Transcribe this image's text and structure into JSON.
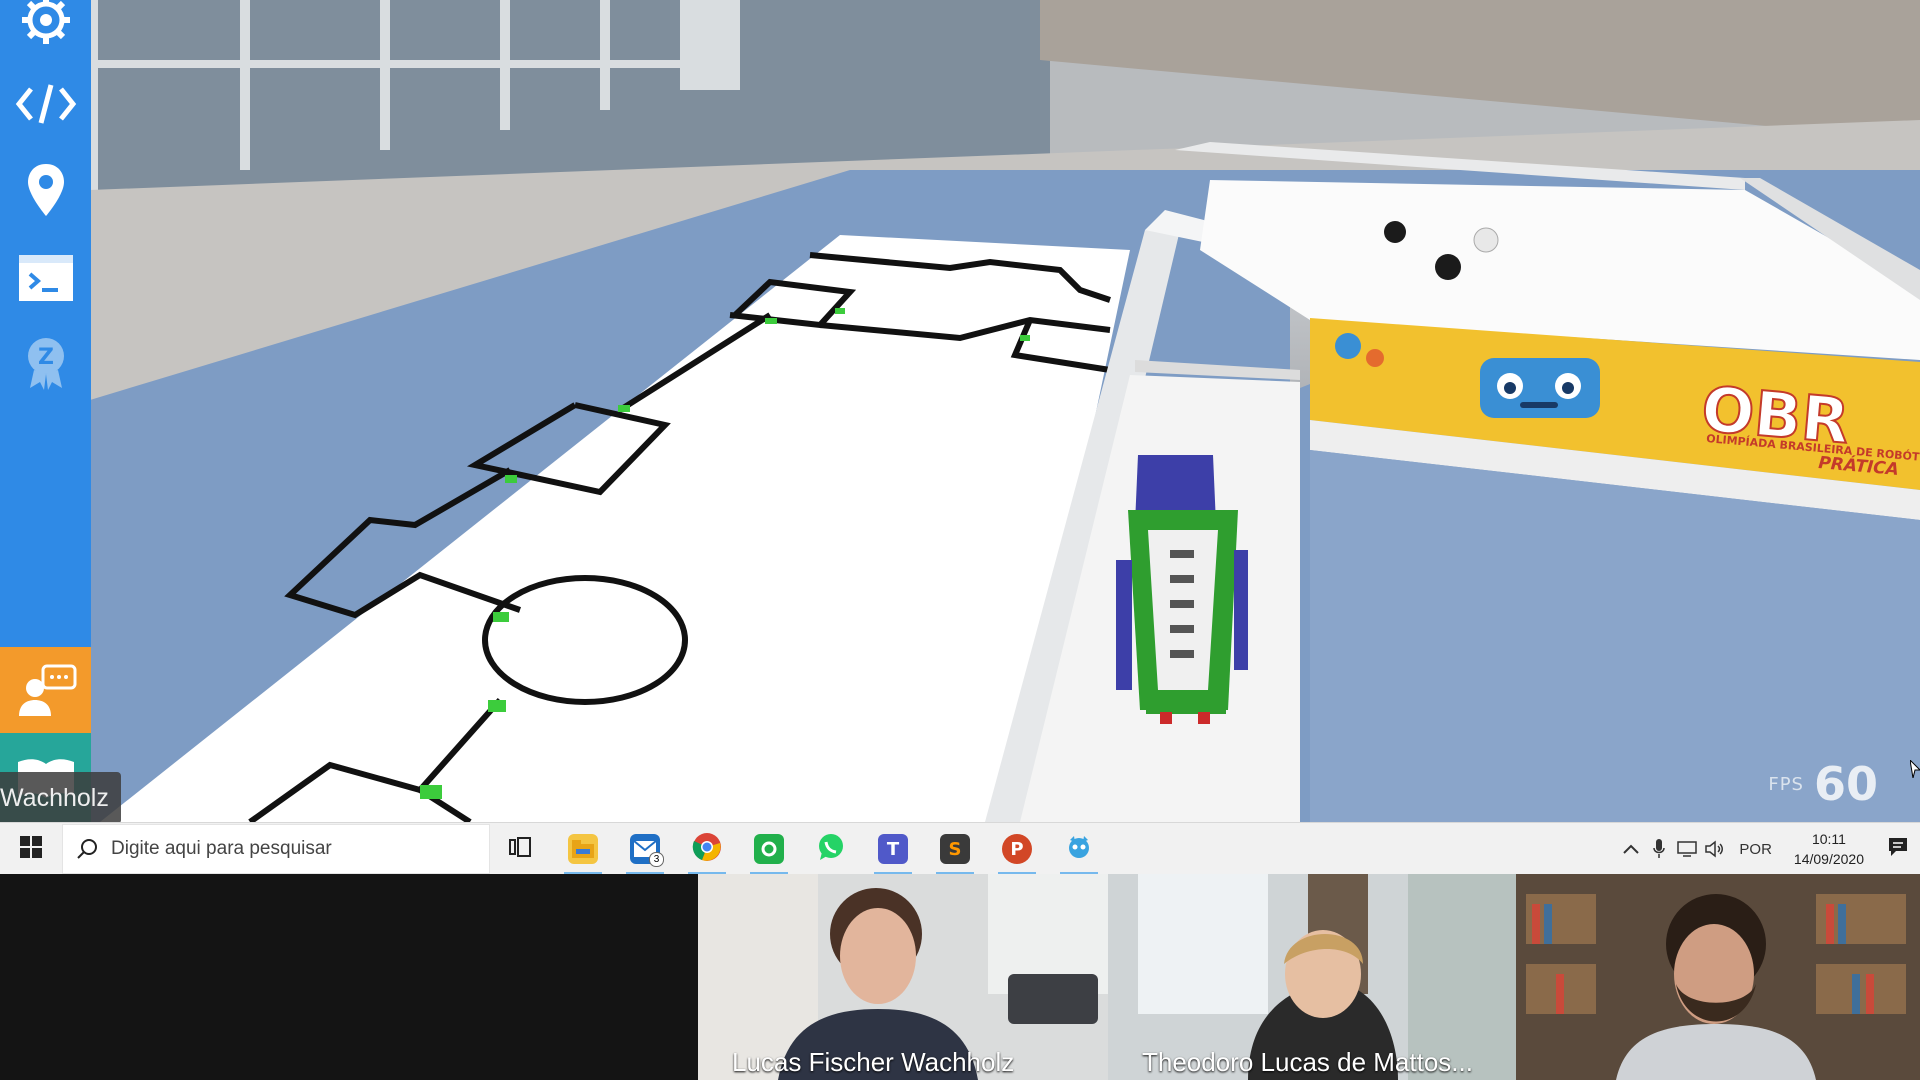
{
  "sidebar": {
    "items": [
      {
        "icon": "gear-icon"
      },
      {
        "icon": "code-icon"
      },
      {
        "icon": "map-pin-icon"
      },
      {
        "icon": "terminal-icon"
      },
      {
        "icon": "badge-icon"
      },
      {
        "icon": "help-chat-icon"
      },
      {
        "icon": "book-icon"
      }
    ]
  },
  "scene": {
    "banner_brand": "OBR",
    "banner_subtitle": "OLIMPÍADA BRASILEIRA DE ROBÓTICA",
    "banner_tag": "PRÁTICA",
    "fps_label": "FPS",
    "fps_value": "60"
  },
  "tooltip": {
    "name": "Wachholz"
  },
  "taskbar": {
    "search_placeholder": "Digite aqui para pesquisar",
    "apps": [
      "task-view-icon",
      "file-explorer-icon",
      "mail-icon",
      "chrome-icon",
      "green-app-icon",
      "whatsapp-icon",
      "teams-icon",
      "sublime-icon",
      "powerpoint-icon",
      "blue-app-icon"
    ],
    "mail_badge": "3",
    "language": "POR",
    "time": "10:11",
    "date": "14/09/2020"
  },
  "participants": [
    {
      "name": "Lucas Fischer Wachholz"
    },
    {
      "name": "Theodoro Lucas de Mattos..."
    },
    {
      "name": ""
    }
  ],
  "colors": {
    "sidebar": "#2f8ae6",
    "help_button": "#f39a2b",
    "book_button": "#26a69a",
    "floor": "#7e9cc4",
    "banner": "#f2c12e"
  }
}
